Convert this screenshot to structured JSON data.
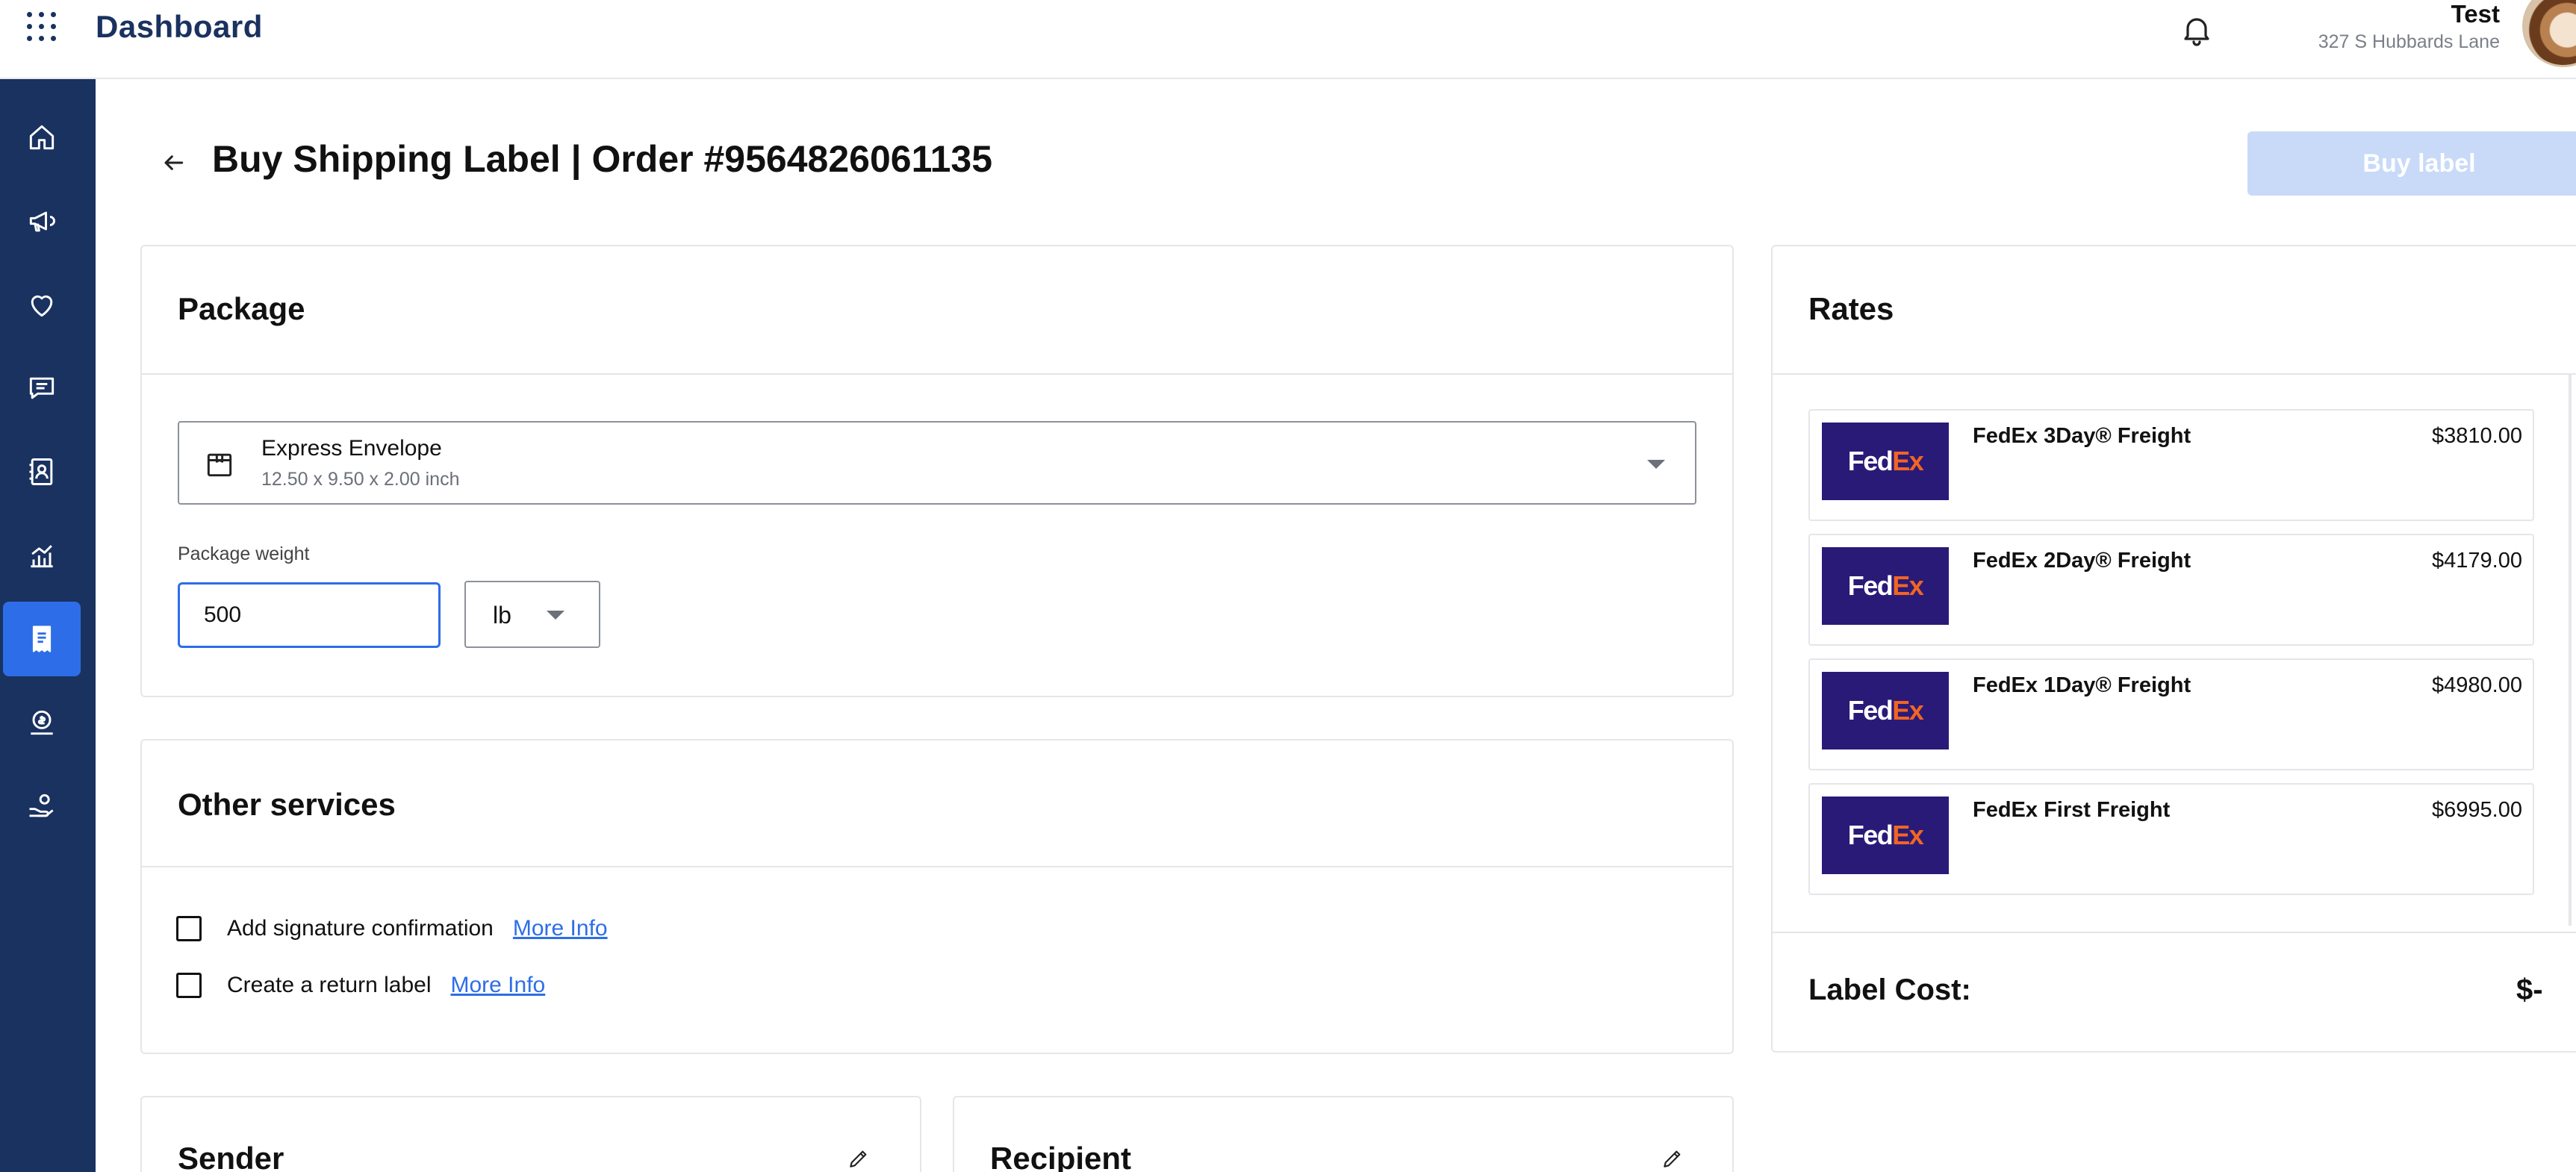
{
  "header": {
    "brand": "Dashboard",
    "user_name": "Test",
    "user_address": "327 S Hubbards Lane"
  },
  "sidebar": {
    "items": [
      {
        "name": "home",
        "icon": "home-icon"
      },
      {
        "name": "marketing",
        "icon": "megaphone-icon"
      },
      {
        "name": "favorites",
        "icon": "heart-icon"
      },
      {
        "name": "messages",
        "icon": "chat-icon"
      },
      {
        "name": "contacts",
        "icon": "contacts-icon"
      },
      {
        "name": "analytics",
        "icon": "chart-icon"
      },
      {
        "name": "orders",
        "icon": "receipt-icon",
        "active": true
      },
      {
        "name": "payments",
        "icon": "money-icon"
      },
      {
        "name": "donations",
        "icon": "hand-coin-icon"
      }
    ]
  },
  "page": {
    "title": "Buy Shipping Label | Order #9564826061135",
    "buy_label_button": "Buy label"
  },
  "package": {
    "title": "Package",
    "selected_name": "Express Envelope",
    "selected_dims": "12.50 x 9.50 x 2.00 inch",
    "weight_label": "Package weight",
    "weight_value": "500",
    "weight_unit": "lb"
  },
  "other_services": {
    "title": "Other services",
    "items": [
      {
        "label": "Add signature confirmation",
        "more_info": "More Info",
        "checked": false
      },
      {
        "label": "Create a return label",
        "more_info": "More Info",
        "checked": false
      }
    ]
  },
  "sender": {
    "title": "Sender"
  },
  "recipient": {
    "title": "Recipient"
  },
  "rates": {
    "title": "Rates",
    "items": [
      {
        "carrier_fed": "Fed",
        "carrier_ex": "Ex",
        "name": "FedEx 3Day® Freight",
        "price": "$3810.00"
      },
      {
        "carrier_fed": "Fed",
        "carrier_ex": "Ex",
        "name": "FedEx 2Day® Freight",
        "price": "$4179.00"
      },
      {
        "carrier_fed": "Fed",
        "carrier_ex": "Ex",
        "name": "FedEx 1Day® Freight",
        "price": "$4980.00"
      },
      {
        "carrier_fed": "Fed",
        "carrier_ex": "Ex",
        "name": "FedEx First Freight",
        "price": "$6995.00"
      }
    ],
    "label_cost_label": "Label Cost:",
    "label_cost_value": "$-"
  },
  "colors": {
    "sidebar_bg": "#1a3260",
    "accent": "#2d6ee8",
    "buy_button_disabled": "#c8daf8",
    "fedex_purple": "#2a1a78",
    "fedex_orange": "#f26522"
  }
}
